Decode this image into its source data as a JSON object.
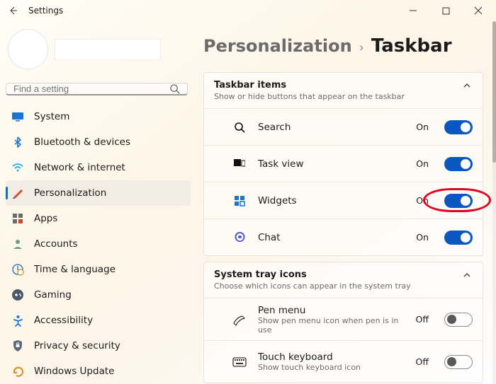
{
  "window": {
    "title": "Settings"
  },
  "search": {
    "placeholder": "Find a setting"
  },
  "breadcrumb": {
    "parent": "Personalization",
    "current": "Taskbar"
  },
  "sidebar": {
    "items": [
      {
        "label": "System"
      },
      {
        "label": "Bluetooth & devices"
      },
      {
        "label": "Network & internet"
      },
      {
        "label": "Personalization"
      },
      {
        "label": "Apps"
      },
      {
        "label": "Accounts"
      },
      {
        "label": "Time & language"
      },
      {
        "label": "Gaming"
      },
      {
        "label": "Accessibility"
      },
      {
        "label": "Privacy & security"
      },
      {
        "label": "Windows Update"
      }
    ]
  },
  "sections": {
    "taskbar_items": {
      "title": "Taskbar items",
      "desc": "Show or hide buttons that appear on the taskbar",
      "rows": [
        {
          "label": "Search",
          "state": "On"
        },
        {
          "label": "Task view",
          "state": "On"
        },
        {
          "label": "Widgets",
          "state": "On"
        },
        {
          "label": "Chat",
          "state": "On"
        }
      ]
    },
    "tray_icons": {
      "title": "System tray icons",
      "desc": "Choose which icons can appear in the system tray",
      "rows": [
        {
          "label": "Pen menu",
          "desc": "Show pen menu icon when pen is in use",
          "state": "Off"
        },
        {
          "label": "Touch keyboard",
          "desc": "Show touch keyboard icon",
          "state": "Off"
        }
      ]
    }
  }
}
